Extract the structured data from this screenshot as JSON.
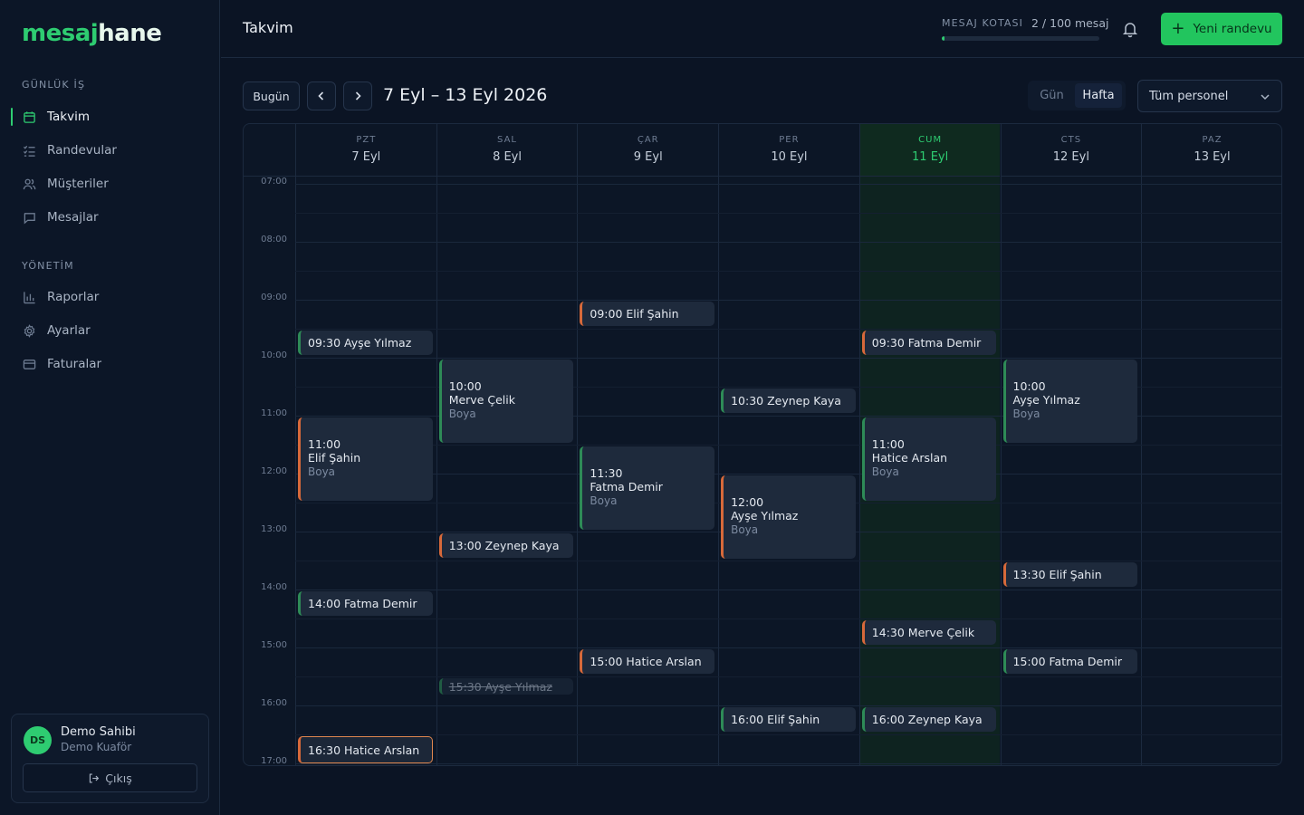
{
  "brand": {
    "part1": "mesaj",
    "part2": "hane"
  },
  "sidebar": {
    "section1": "GÜNLÜK İŞ",
    "section2": "YÖNETİM",
    "items": [
      {
        "label": "Takvim",
        "icon": "calendar-icon"
      },
      {
        "label": "Randevular",
        "icon": "list-check-icon"
      },
      {
        "label": "Müşteriler",
        "icon": "users-icon"
      },
      {
        "label": "Mesajlar",
        "icon": "message-icon"
      },
      {
        "label": "Raporlar",
        "icon": "bar-chart-icon"
      },
      {
        "label": "Ayarlar",
        "icon": "gear-icon"
      },
      {
        "label": "Faturalar",
        "icon": "credit-card-icon"
      }
    ],
    "user": {
      "initials": "DS",
      "name": "Demo Sahibi",
      "business": "Demo Kuaför",
      "logout": "Çıkış"
    }
  },
  "header": {
    "title": "Takvim",
    "quota_label": "MESAJ KOTASI",
    "quota_value": "2 / 100 mesaj",
    "quota_fraction": 0.02,
    "new_button": "Yeni randevu"
  },
  "toolbar": {
    "today": "Bugün",
    "range": "7 Eyl – 13 Eyl 2026",
    "view_day": "Gün",
    "view_week": "Hafta",
    "staff_filter": "Tüm personel"
  },
  "calendar": {
    "days": [
      {
        "name": "PZT",
        "date": "7 Eyl"
      },
      {
        "name": "SAL",
        "date": "8 Eyl"
      },
      {
        "name": "ÇAR",
        "date": "9 Eyl"
      },
      {
        "name": "PER",
        "date": "10 Eyl"
      },
      {
        "name": "CUM",
        "date": "11 Eyl",
        "today": true
      },
      {
        "name": "CTS",
        "date": "12 Eyl"
      },
      {
        "name": "PAZ",
        "date": "13 Eyl"
      }
    ],
    "hours": [
      "07:00",
      "08:00",
      "09:00",
      "10:00",
      "11:00",
      "12:00",
      "13:00",
      "14:00",
      "15:00",
      "16:00",
      "17:00"
    ],
    "events": [
      {
        "day": 0,
        "start": "09:30",
        "name": "Ayşe Yılmaz",
        "color": "gr"
      },
      {
        "day": 0,
        "start": "11:00",
        "name": "Elif Şahin",
        "service": "Boya",
        "color": "or"
      },
      {
        "day": 0,
        "start": "14:00",
        "name": "Fatma Demir",
        "color": "gr"
      },
      {
        "day": 0,
        "start": "16:30",
        "name": "Hatice Arslan",
        "color": "or",
        "selected": true
      },
      {
        "day": 1,
        "start": "10:00",
        "name": "Merve Çelik",
        "service": "Boya",
        "color": "gr"
      },
      {
        "day": 1,
        "start": "13:00",
        "name": "Zeynep Kaya",
        "color": "or"
      },
      {
        "day": 1,
        "start": "15:30",
        "name": "Ayşe Yılmaz",
        "color": "gr",
        "cancelled": true
      },
      {
        "day": 2,
        "start": "09:00",
        "name": "Elif Şahin",
        "color": "or"
      },
      {
        "day": 2,
        "start": "11:30",
        "name": "Fatma Demir",
        "service": "Boya",
        "color": "gr"
      },
      {
        "day": 2,
        "start": "15:00",
        "name": "Hatice Arslan",
        "color": "or"
      },
      {
        "day": 3,
        "start": "10:30",
        "name": "Zeynep Kaya",
        "color": "gr"
      },
      {
        "day": 3,
        "start": "12:00",
        "name": "Ayşe Yılmaz",
        "service": "Boya",
        "color": "or"
      },
      {
        "day": 3,
        "start": "16:00",
        "name": "Elif Şahin",
        "color": "gr"
      },
      {
        "day": 4,
        "start": "09:30",
        "name": "Fatma Demir",
        "color": "or"
      },
      {
        "day": 4,
        "start": "11:00",
        "name": "Hatice Arslan",
        "service": "Boya",
        "color": "gr"
      },
      {
        "day": 4,
        "start": "14:30",
        "name": "Merve Çelik",
        "color": "or"
      },
      {
        "day": 4,
        "start": "16:00",
        "name": "Zeynep Kaya",
        "color": "gr"
      },
      {
        "day": 5,
        "start": "10:00",
        "name": "Ayşe Yılmaz",
        "service": "Boya",
        "color": "gr"
      },
      {
        "day": 5,
        "start": "13:30",
        "name": "Elif Şahin",
        "color": "or"
      },
      {
        "day": 5,
        "start": "15:00",
        "name": "Fatma Demir",
        "color": "gr"
      }
    ]
  },
  "colors": {
    "accent": "#22c55e",
    "orange": "#d7693a",
    "green_bar": "#2e8b57"
  }
}
